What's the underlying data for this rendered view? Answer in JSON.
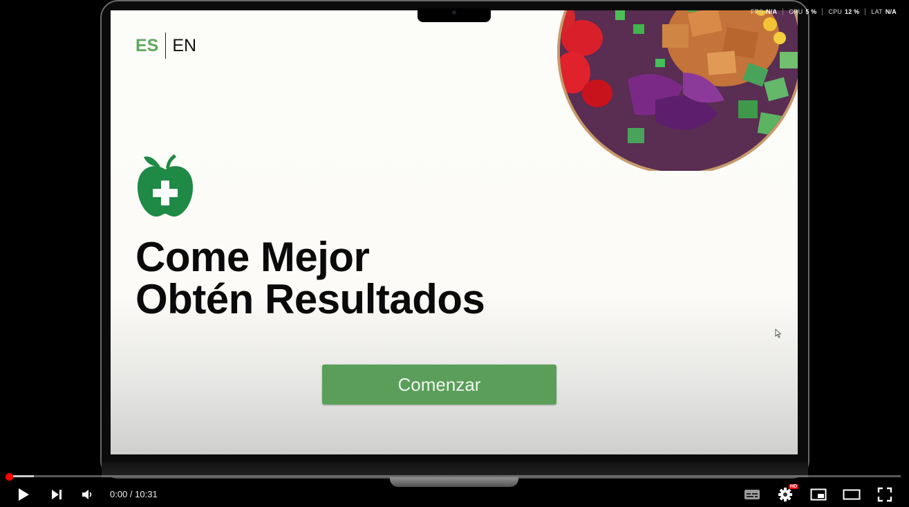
{
  "language_switch": {
    "es_label": "ES",
    "en_label": "EN"
  },
  "hero": {
    "headline_line1": "Come Mejor",
    "headline_line2": "Obtén Resultados",
    "cta_label": "Comenzar",
    "logo_icon": "apple-plus-icon",
    "image": "salad-bowl"
  },
  "perf_overlay": [
    {
      "label": "FPS",
      "value": "N/A"
    },
    {
      "label": "GPU",
      "value": "5 %"
    },
    {
      "label": "CPU",
      "value": "12 %"
    },
    {
      "label": "LAT",
      "value": "N/A"
    }
  ],
  "player": {
    "current_time": "0:00",
    "duration": "10:31",
    "time_display": "0:00 / 10:31",
    "progress": 0.0,
    "quality_badge": "HD",
    "icons": [
      "play-icon",
      "next-icon",
      "volume-icon",
      "subtitles-icon",
      "settings-icon",
      "miniplayer-icon",
      "theater-icon",
      "fullscreen-icon"
    ]
  },
  "colors": {
    "brand_green": "#5a9e5a",
    "es_green": "#5fa85f",
    "progress_red": "#ff0000"
  }
}
